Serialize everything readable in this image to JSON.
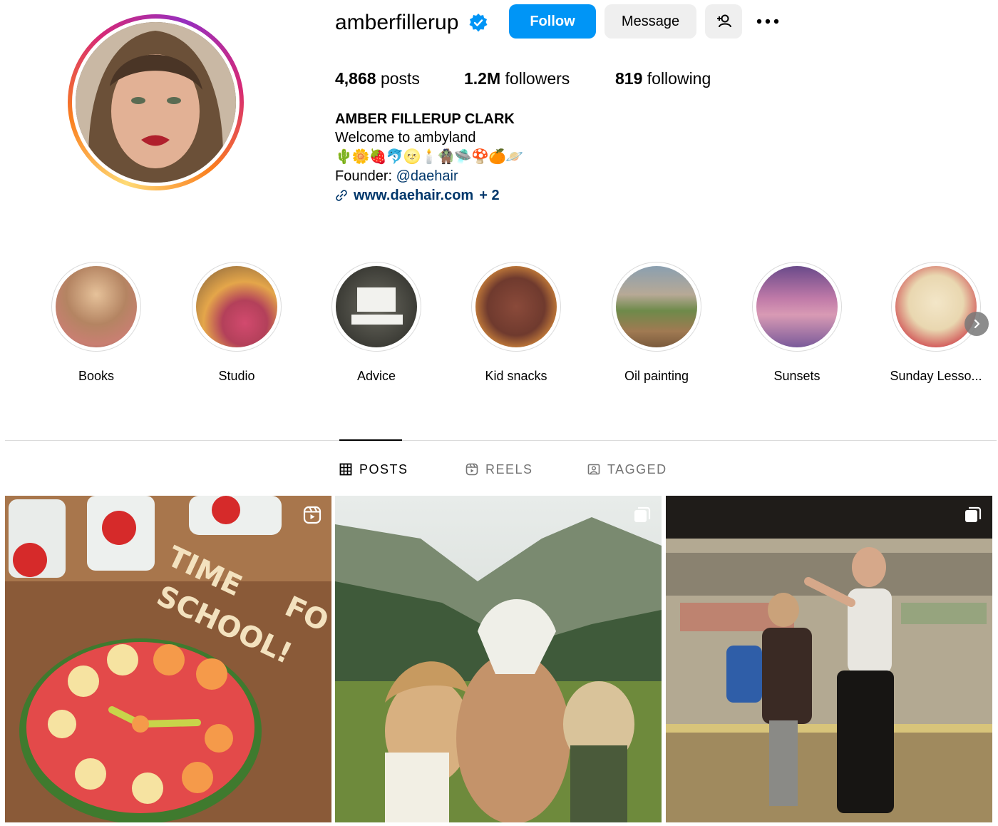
{
  "profile": {
    "username": "amberfillerup",
    "follow_label": "Follow",
    "message_label": "Message",
    "stats": {
      "posts_count": "4,868",
      "posts_label": "posts",
      "followers_count": "1.2M",
      "followers_label": "followers",
      "following_count": "819",
      "following_label": "following"
    },
    "bio": {
      "full_name": "AMBER FILLERUP CLARK",
      "line1": "Welcome to ambyland",
      "emoji_line": "🌵🌼🍓🐬🌝🕯️🧌🛸🍄🍊🪐",
      "founder_prefix": "Founder: ",
      "founder_mention": "@daehair",
      "link_text": "www.daehair.com",
      "link_extra": "+ 2"
    }
  },
  "highlights": [
    {
      "label": "Books"
    },
    {
      "label": "Studio"
    },
    {
      "label": "Advice"
    },
    {
      "label": "Kid snacks"
    },
    {
      "label": "Oil painting"
    },
    {
      "label": "Sunsets"
    },
    {
      "label": "Sunday Lesso..."
    }
  ],
  "tabs": {
    "posts": "POSTS",
    "reels": "REELS",
    "tagged": "TAGGED"
  },
  "posts": [
    {
      "type": "reel",
      "icon": "reel-icon"
    },
    {
      "type": "carousel",
      "icon": "carousel-icon"
    },
    {
      "type": "carousel",
      "icon": "carousel-icon"
    }
  ],
  "colors": {
    "accent": "#0095f6",
    "link": "#00376b",
    "button_gray": "#efefef",
    "muted_text": "#737373"
  }
}
